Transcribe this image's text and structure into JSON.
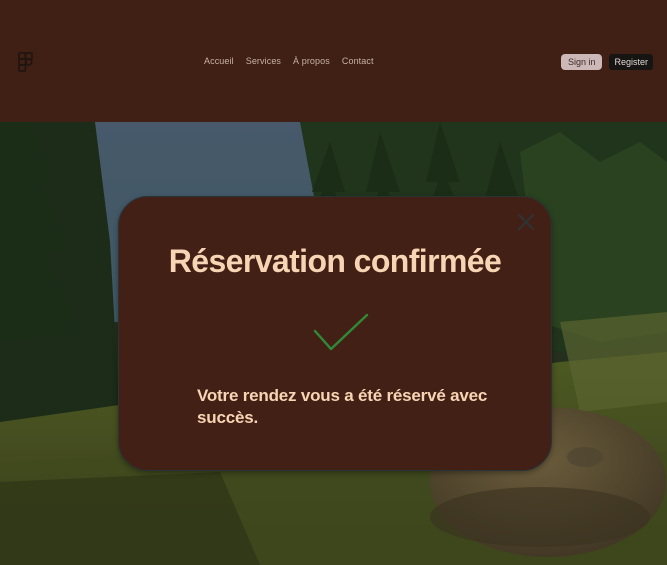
{
  "header": {
    "logo_icon": "figma-logo-icon",
    "nav": [
      {
        "label": "Accueil"
      },
      {
        "label": "Services"
      },
      {
        "label": "À propos"
      },
      {
        "label": "Contact"
      }
    ],
    "signin_label": "Sign in",
    "register_label": "Register"
  },
  "hero": {
    "image": "forest-clearing-with-boulder"
  },
  "modal": {
    "title": "Réservation confirmée",
    "check_icon": "checkmark-icon",
    "close_icon": "close-icon",
    "message": "Votre rendez vous a été réservé avec succès."
  },
  "colors": {
    "header_bg": "#401f15",
    "modal_bg": "#432015",
    "modal_text": "#f7d4b4",
    "check": "#2f8a38"
  }
}
